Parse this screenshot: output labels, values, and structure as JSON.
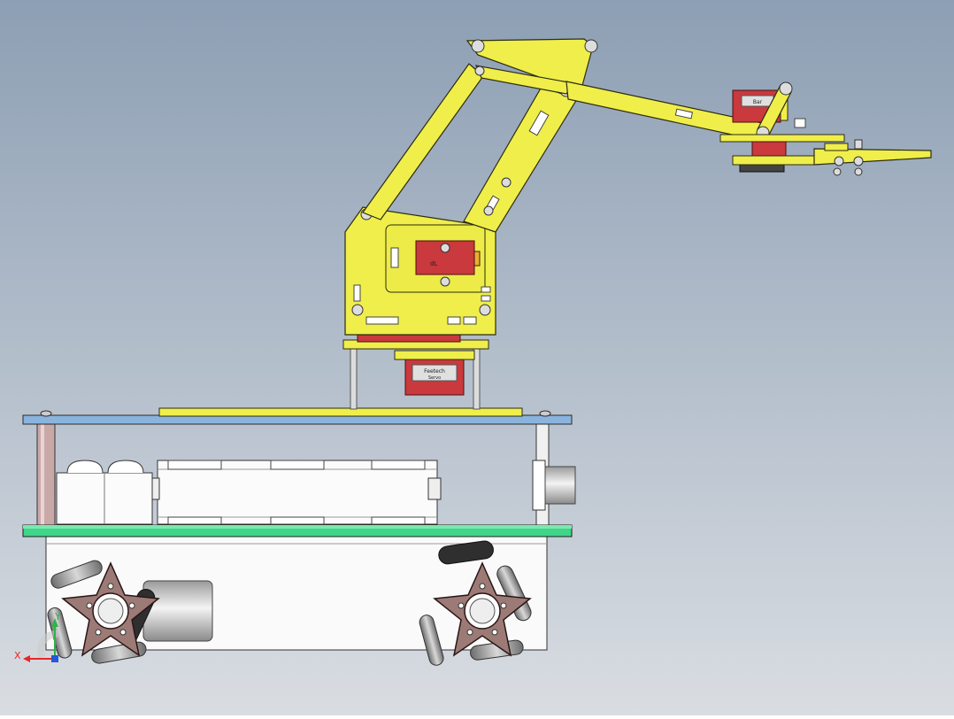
{
  "viewport": {
    "background_top": "#8d9fb4",
    "background_bottom": "#d9dde2"
  },
  "colors": {
    "arm_yellow": "#f0ee4a",
    "arm_outline": "#2c2c10",
    "servo_red": "#c9393d",
    "servo_dark": "#7a1d20",
    "top_plate_blue": "#8ab4de",
    "bottom_plate_green": "#3fd68a",
    "chassis_white": "#fafafa",
    "wheel_hub_brown": "#9c7a76",
    "roller_grey": "#8c8c8c",
    "axis_x": "#e8262a",
    "axis_y": "#2fb34a",
    "axis_z": "#2459d8"
  },
  "servo_labels": {
    "base_servo": "Feetech",
    "base_servo_sub": "Servo",
    "shoulder_servo_a": "dL",
    "gripper_servo": "Bar"
  },
  "triad": {
    "x_label": "X",
    "y_label": "Y"
  }
}
